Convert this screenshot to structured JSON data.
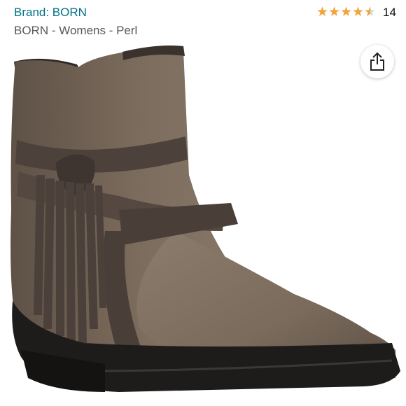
{
  "header": {
    "brand_label": "Brand: BORN",
    "title": "BORN - Womens - Perl",
    "rating": {
      "stars": 4.5,
      "max_stars": 5,
      "count": "14",
      "star_color": "#f0a43a"
    }
  },
  "share": {
    "icon": "share-icon"
  },
  "product": {
    "image": "brown leather ankle boot with fringe strap",
    "leather_color": "#7d6d5e",
    "suede_color": "#4d423b",
    "sole_color": "#1e1c1b"
  }
}
